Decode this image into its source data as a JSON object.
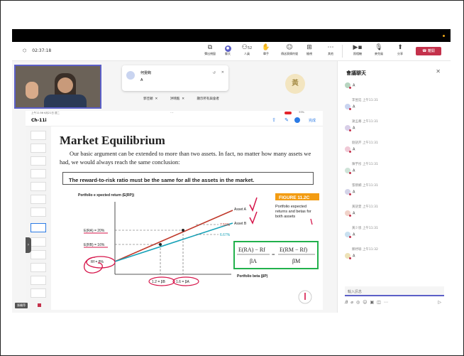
{
  "meeting": {
    "timer": "02:37:18",
    "toolbar": [
      {
        "icon": "share-tray-icon",
        "label": "彈出視窗"
      },
      {
        "icon": "chat-icon",
        "label": "聊天",
        "active": true
      },
      {
        "icon": "people-icon",
        "label": "人員",
        "badge": "52"
      },
      {
        "icon": "raise-hand-icon",
        "label": "舉手"
      },
      {
        "icon": "reactions-icon",
        "label": "傳送表情符號"
      },
      {
        "icon": "view-icon",
        "label": "檢視"
      },
      {
        "icon": "more-icon",
        "label": "其他"
      }
    ],
    "camera_label": "照相機",
    "mic_label": "麥克風",
    "share_label": "分享",
    "leave_label": "離開"
  },
  "stage": {
    "notification": {
      "name": "何雯絢",
      "text": "A"
    },
    "avatar_initial": "黃",
    "participants": [
      "郭佳穎",
      "洪晴甄",
      "顯示所有與會者"
    ],
    "presenter_tag": "張曉萍"
  },
  "ipad": {
    "status_time": "上午11:56 6月21日 週二",
    "battery": "93%",
    "doc_title": "Ch-11i",
    "done_label": "完成"
  },
  "slide": {
    "title": "Market Equilibrium",
    "body": "Our basic argument can be extended to more than two assets. In fact, no matter how many assets we had, we would always reach the same conclusion:",
    "highlight": "The reward-to-risk ratio must be the same for all the assets in the market.",
    "figure_label": "FIGURE 11.2C",
    "figure_caption": "Portfolio expected returns and betas for both assets",
    "y_axis_label": "Portfolio e xpected return (E(RP))",
    "x_axis_label": "Portfolio beta (βP)",
    "asset_a": "Asset A",
    "asset_b": "Asset B",
    "slope_a": "7.50%",
    "slope_b": "6.67%",
    "y_ticks": [
      "E(RA) = 20%",
      "E(RB) = 16%",
      "Rf = 8%"
    ],
    "x_ticks": [
      "1.2 = βB",
      "1.6 = βA"
    ],
    "formula_left_num": "E(RA) − Rf",
    "formula_left_den": "βA",
    "formula_right_num": "E(RM − Rf)",
    "formula_right_den": "βM",
    "colors": {
      "asset_a": "#c0392b",
      "asset_b": "#17a2b8",
      "annotation": "#d6154a",
      "formula_box": "#22b14c",
      "figure_tag": "#f39c12"
    }
  },
  "chat": {
    "title": "會議聊天",
    "messages": [
      {
        "author": "",
        "time": "",
        "text": "A",
        "color": "#b7d5c0"
      },
      {
        "author": "李昱廷",
        "time": "上午11:31",
        "text": "A",
        "color": "#c9d4f0"
      },
      {
        "author": "謝孟蓁",
        "time": "上午11:31",
        "text": "A",
        "color": "#d8cfe8"
      },
      {
        "author": "劉語芹",
        "time": "上午11:31",
        "text": "A",
        "color": "#f0c9d6"
      },
      {
        "author": "陳芋彤",
        "time": "上午11:31",
        "text": "A",
        "color": "#cfe3d8"
      },
      {
        "author": "張慈嫻",
        "time": "上午11:31",
        "text": "A",
        "color": "#d3d3e8"
      },
      {
        "author": "黃語萱",
        "time": "上午11:31",
        "text": "A",
        "color": "#f0d2c9"
      },
      {
        "author": "黃少恩",
        "time": "上午11:31",
        "text": "A",
        "color": "#c9e0f0"
      },
      {
        "author": "鄭妤瑜",
        "time": "上午11:32",
        "text": "A",
        "color": "#ede2b8"
      }
    ],
    "input_placeholder": "輸入訊息"
  }
}
